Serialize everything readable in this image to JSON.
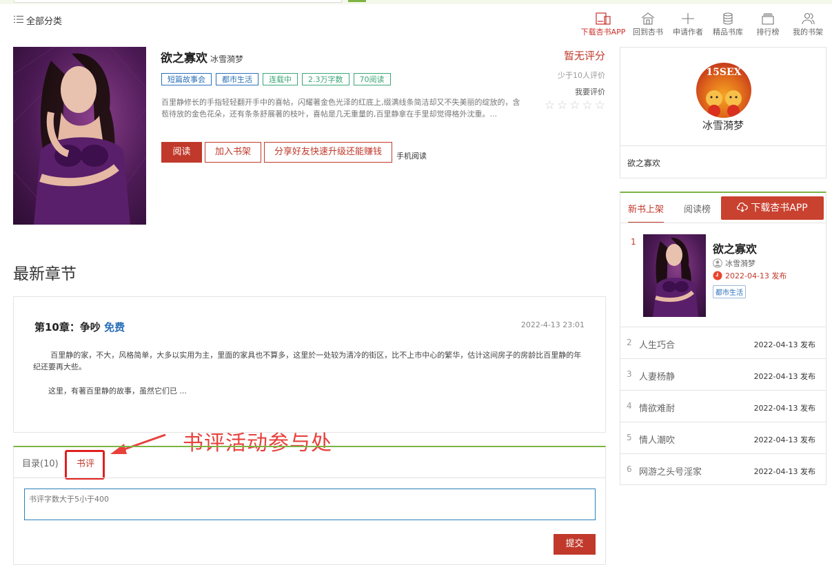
{
  "header": {
    "category_menu": "全部分类",
    "nav": [
      {
        "label": "下载杏书APP",
        "icon": "tablet-icon"
      },
      {
        "label": "回到杏书",
        "icon": "home-icon"
      },
      {
        "label": "申请作者",
        "icon": "plus-icon"
      },
      {
        "label": "精品书库",
        "icon": "database-icon"
      },
      {
        "label": "排行榜",
        "icon": "box-icon"
      },
      {
        "label": "我的书架",
        "icon": "users-icon"
      }
    ]
  },
  "book": {
    "title": "欲之寡欢",
    "author": "冰雪漪梦",
    "tags": [
      "短篇故事会",
      "都市生活",
      "连载中",
      "2.3万字数",
      "70阅读"
    ],
    "description": "百里静修长的手指轻轻翻开手中的喜帖，闪耀著金色光泽的红底上,缀满线条简洁却又不失美丽的绽放的，含苞待放的金色花朵，还有条条舒展著的枝叶，喜帖是几无重量的,百里静拿在手里却觉得格外沈重。...",
    "buttons": {
      "read": "阅读",
      "shelf": "加入书架",
      "share": "分享好友快速升级还能赚钱",
      "mobile": "手机阅读"
    }
  },
  "rating": {
    "score": "暂无评分",
    "few": "少于10人评价",
    "rate_label": "我要评价",
    "stars": [
      "☆",
      "☆",
      "☆",
      "☆",
      "☆"
    ]
  },
  "author_card": {
    "avatar_text": "15SEX",
    "name": "冰雪漪梦",
    "book": "欲之寡欢"
  },
  "latest": {
    "heading": "最新章节",
    "chapter_title": "第10章：争吵",
    "free": "免费",
    "time": "2022-4-13 23:01",
    "paragraphs": [
      "百里静的家，不大，风格简单，大多以实用为主，里面的家具也不算多，这里於一处较为清冷的街区，比不上市中心的繁华，估计这间房子的房龄比百里静的年纪还要再大些。",
      "这里，有著百里静的故事，虽然它们已 ..."
    ]
  },
  "annotation": "书评活动参与处",
  "tabs": {
    "catalog": "目录(10)",
    "review": "书评",
    "review_placeholder": "书评字数大于5小于400",
    "submit": "提交"
  },
  "rank": {
    "tabs": [
      "新书上架",
      "阅读榜"
    ],
    "download": "下载杏书APP",
    "first": {
      "num": "1",
      "title": "欲之寡欢",
      "author": "冰雪漪梦",
      "date": "2022-04-13 发布",
      "tag": "都市生活"
    },
    "items": [
      {
        "num": "2",
        "name": "人生巧合",
        "date": "2022-04-13 发布"
      },
      {
        "num": "3",
        "name": "人妻杨静",
        "date": "2022-04-13 发布"
      },
      {
        "num": "4",
        "name": "情欲难耐",
        "date": "2022-04-13 发布"
      },
      {
        "num": "5",
        "name": "情人潮吹",
        "date": "2022-04-13 发布"
      },
      {
        "num": "6",
        "name": "网游之头号淫家",
        "date": "2022-04-13 发布"
      }
    ]
  },
  "colors": {
    "accent": "#c0392b",
    "green_rule": "#7cb342",
    "link_blue": "#2a6fb8"
  }
}
